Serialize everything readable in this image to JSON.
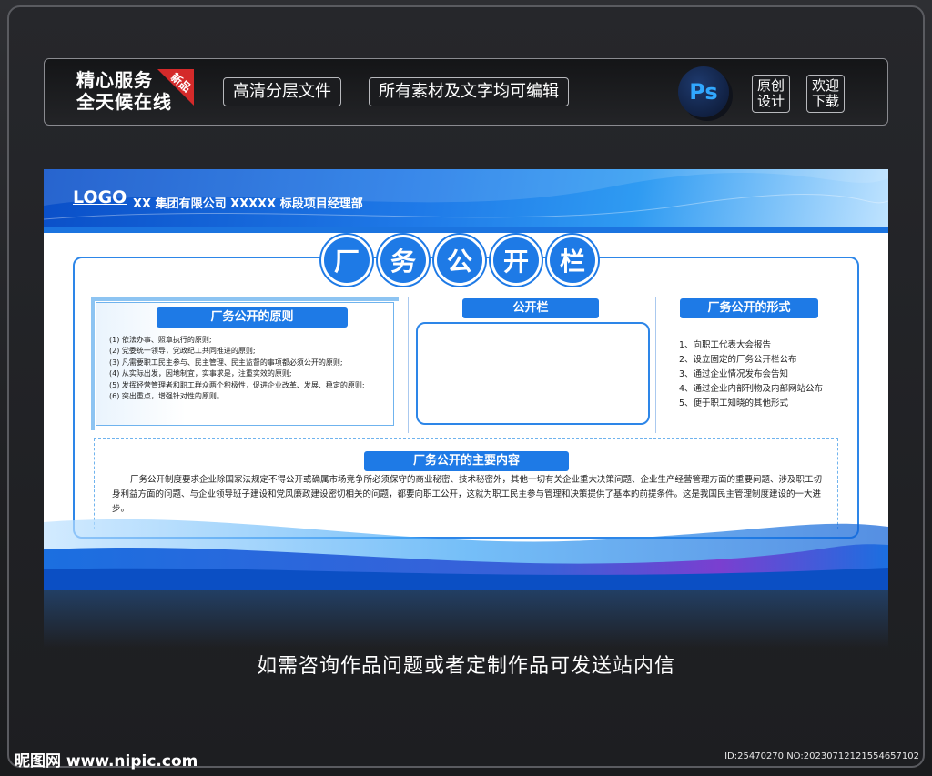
{
  "header": {
    "service_line1": "精心服务",
    "service_line2": "全天候在线",
    "badge": "新品",
    "pill1": "高清分层文件",
    "pill2": "所有素材及文字均可编辑",
    "ps_label": "Ps",
    "box1_line1": "原创",
    "box1_line2": "设计",
    "box2_line1": "欢迎",
    "box2_line2": "下载"
  },
  "poster": {
    "logo": "LOGO",
    "company": "XX 集团有限公司 XXXXX 标段项目经理部",
    "title_chars": [
      "厂",
      "务",
      "公",
      "开",
      "栏"
    ],
    "left_title": "厂务公开的原则",
    "principles": [
      "(1) 依法办事、照章执行的原则;",
      "(2) 党委统一领导，党政纪工共同推进的原则;",
      "(3) 凡需要职工民主参与、民主管理、民主监督的事项都必须公开的原则;",
      "(4) 从实际出发，因地制宜，实事求是，注重实效的原则;",
      "(5) 发挥经营管理者和职工群众两个积极性，促进企业改革、发展、稳定的原则;",
      "(6) 突出重点，增强针对性的原则。"
    ],
    "mid_title": "公开栏",
    "right_title": "厂务公开的形式",
    "forms": [
      "1、向职工代表大会报告",
      "2、设立固定的厂务公开栏公布",
      "3、通过企业情况发布会告知",
      "4、通过企业内部刊物及内部网站公布",
      "5、便于职工知晓的其他形式"
    ],
    "content_title": "厂务公开的主要内容",
    "content_text": "厂务公开制度要求企业除国家法规定不得公开或确属市场竞争所必须保守的商业秘密、技术秘密外，其他一切有关企业重大决策问题、企业生产经营管理方面的重要问题、涉及职工切身利益方面的问题、与企业领导班子建设和党风廉政建设密切相关的问题，都要向职工公开，这就为职工民主参与管理和决策提供了基本的前提条件。这是我国民主管理制度建设的一大进步。"
  },
  "caption": "如需咨询作品问题或者定制作品可发送站内信",
  "footer": {
    "site": "昵图网 www.nipic.com",
    "id": "ID:25470270 NO:20230712121554657102"
  },
  "colors": {
    "accent_blue": "#1e7ae6",
    "badge_red": "#d42a2a",
    "ps_blue": "#31a8ff"
  }
}
